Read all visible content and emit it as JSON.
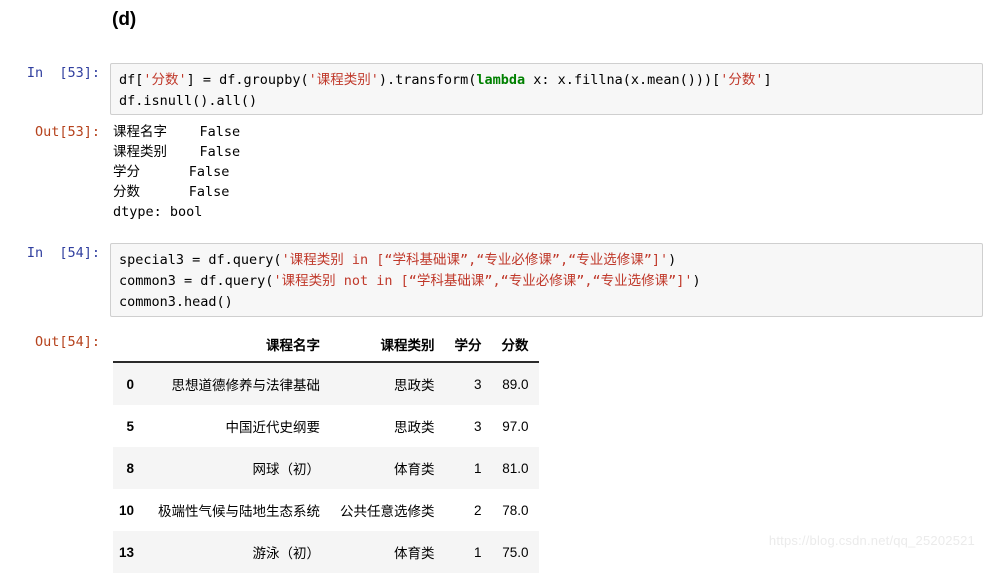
{
  "figure": {
    "label": "(d)"
  },
  "cells": [
    {
      "prompt_in": "In  [53]:",
      "prompt_out": "Out[53]:",
      "code": {
        "line1_a": "df[",
        "line1_str1": "'分数'",
        "line1_b": "] = df.groupby(",
        "line1_str2": "'课程类别'",
        "line1_c": ").transform(",
        "line1_kw": "lambda",
        "line1_d": " x: x.fillna(x.mean()))[",
        "line1_str3": "'分数'",
        "line1_e": "]",
        "line2": "df.isnull().all()"
      },
      "output_text": "课程名字    False\n课程类别    False\n学分      False\n分数      False\ndtype: bool"
    },
    {
      "prompt_in": "In  [54]:",
      "prompt_out": "Out[54]:",
      "code": {
        "line1_a": "special3 = df.query(",
        "line1_str": "'课程类别 in [“学科基础课”,“专业必修课”,“专业选修课”]'",
        "line1_b": ")",
        "line2_a": "common3 = df.query(",
        "line2_str": "'课程类别 not in [“学科基础课”,“专业必修课”,“专业选修课”]'",
        "line2_b": ")",
        "line3": "common3.head()"
      }
    }
  ],
  "dataframe": {
    "index_header": "",
    "columns": [
      "课程名字",
      "课程类别",
      "学分",
      "分数"
    ],
    "rows": [
      {
        "index": "0",
        "cells": [
          "思想道德修养与法律基础",
          "思政类",
          "3",
          "89.0"
        ]
      },
      {
        "index": "5",
        "cells": [
          "中国近代史纲要",
          "思政类",
          "3",
          "97.0"
        ]
      },
      {
        "index": "8",
        "cells": [
          "网球（初）",
          "体育类",
          "1",
          "81.0"
        ]
      },
      {
        "index": "10",
        "cells": [
          "极端性气候与陆地生态系统",
          "公共任意选修类",
          "2",
          "78.0"
        ]
      },
      {
        "index": "13",
        "cells": [
          "游泳（初）",
          "体育类",
          "1",
          "75.0"
        ]
      }
    ]
  },
  "watermark": {
    "text": "https://blog.csdn.net/qq_25202521"
  },
  "colors": {
    "prompt_in": "#303f9f",
    "prompt_out": "#b5411b",
    "string_token": "#c0392b",
    "keyword_token": "#008000",
    "cell_border": "#cfcfcf",
    "cell_bg": "#f7f7f7",
    "row_stripe": "#f5f5f5"
  }
}
